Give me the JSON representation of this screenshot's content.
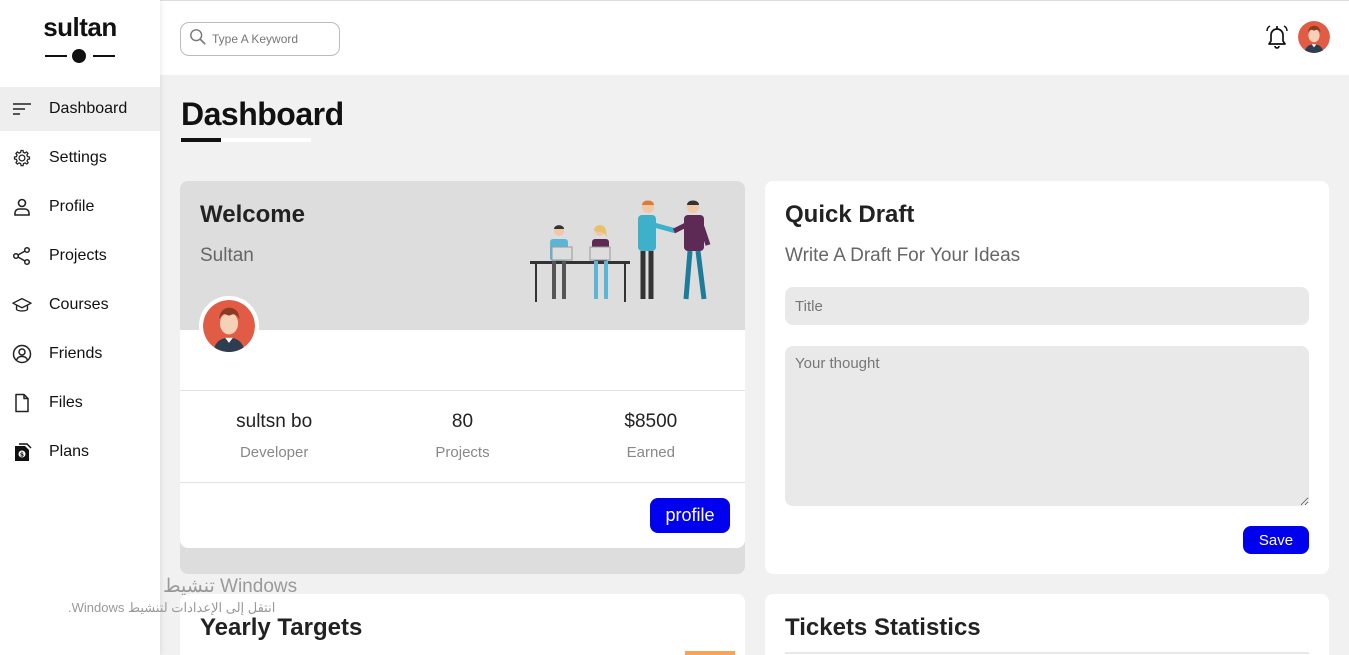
{
  "brand": {
    "name": "sultan"
  },
  "sidebar": {
    "items": [
      {
        "label": "Dashboard",
        "icon": "menu-lines-icon",
        "active": true
      },
      {
        "label": "Settings",
        "icon": "gear-icon"
      },
      {
        "label": "Profile",
        "icon": "user-icon"
      },
      {
        "label": "Projects",
        "icon": "share-nodes-icon"
      },
      {
        "label": "Courses",
        "icon": "graduation-cap-icon"
      },
      {
        "label": "Friends",
        "icon": "user-circle-icon"
      },
      {
        "label": "Files",
        "icon": "file-icon"
      },
      {
        "label": "Plans",
        "icon": "dollar-file-icon"
      }
    ]
  },
  "header": {
    "search_placeholder": "Type A Keyword",
    "icons": [
      "search-icon",
      "bell-icon",
      "avatar"
    ]
  },
  "page": {
    "title": "Dashboard"
  },
  "welcome": {
    "title": "Welcome",
    "name": "Sultan",
    "stats": [
      {
        "value": "sultsn bo",
        "label": "Developer"
      },
      {
        "value": "80",
        "label": "Projects"
      },
      {
        "value": "$8500",
        "label": "Earned"
      }
    ],
    "profile_button": "profile"
  },
  "quick_draft": {
    "title": "Quick Draft",
    "subtitle": "Write A Draft For Your Ideas",
    "title_placeholder": "Title",
    "thought_placeholder": "Your thought",
    "save_button": "Save"
  },
  "bottom_cards": {
    "yearly_title": "Yearly Targets",
    "tickets_title": "Tickets Statistics"
  },
  "watermark": {
    "line1": "تنشيط Windows",
    "line2": "انتقل إلى الإعدادات لتنشيط Windows."
  },
  "colors": {
    "accent": "#0000ee",
    "sidebar_active": "#eeeeee",
    "background": "#f1f1f1",
    "card_header": "#dddddd"
  }
}
